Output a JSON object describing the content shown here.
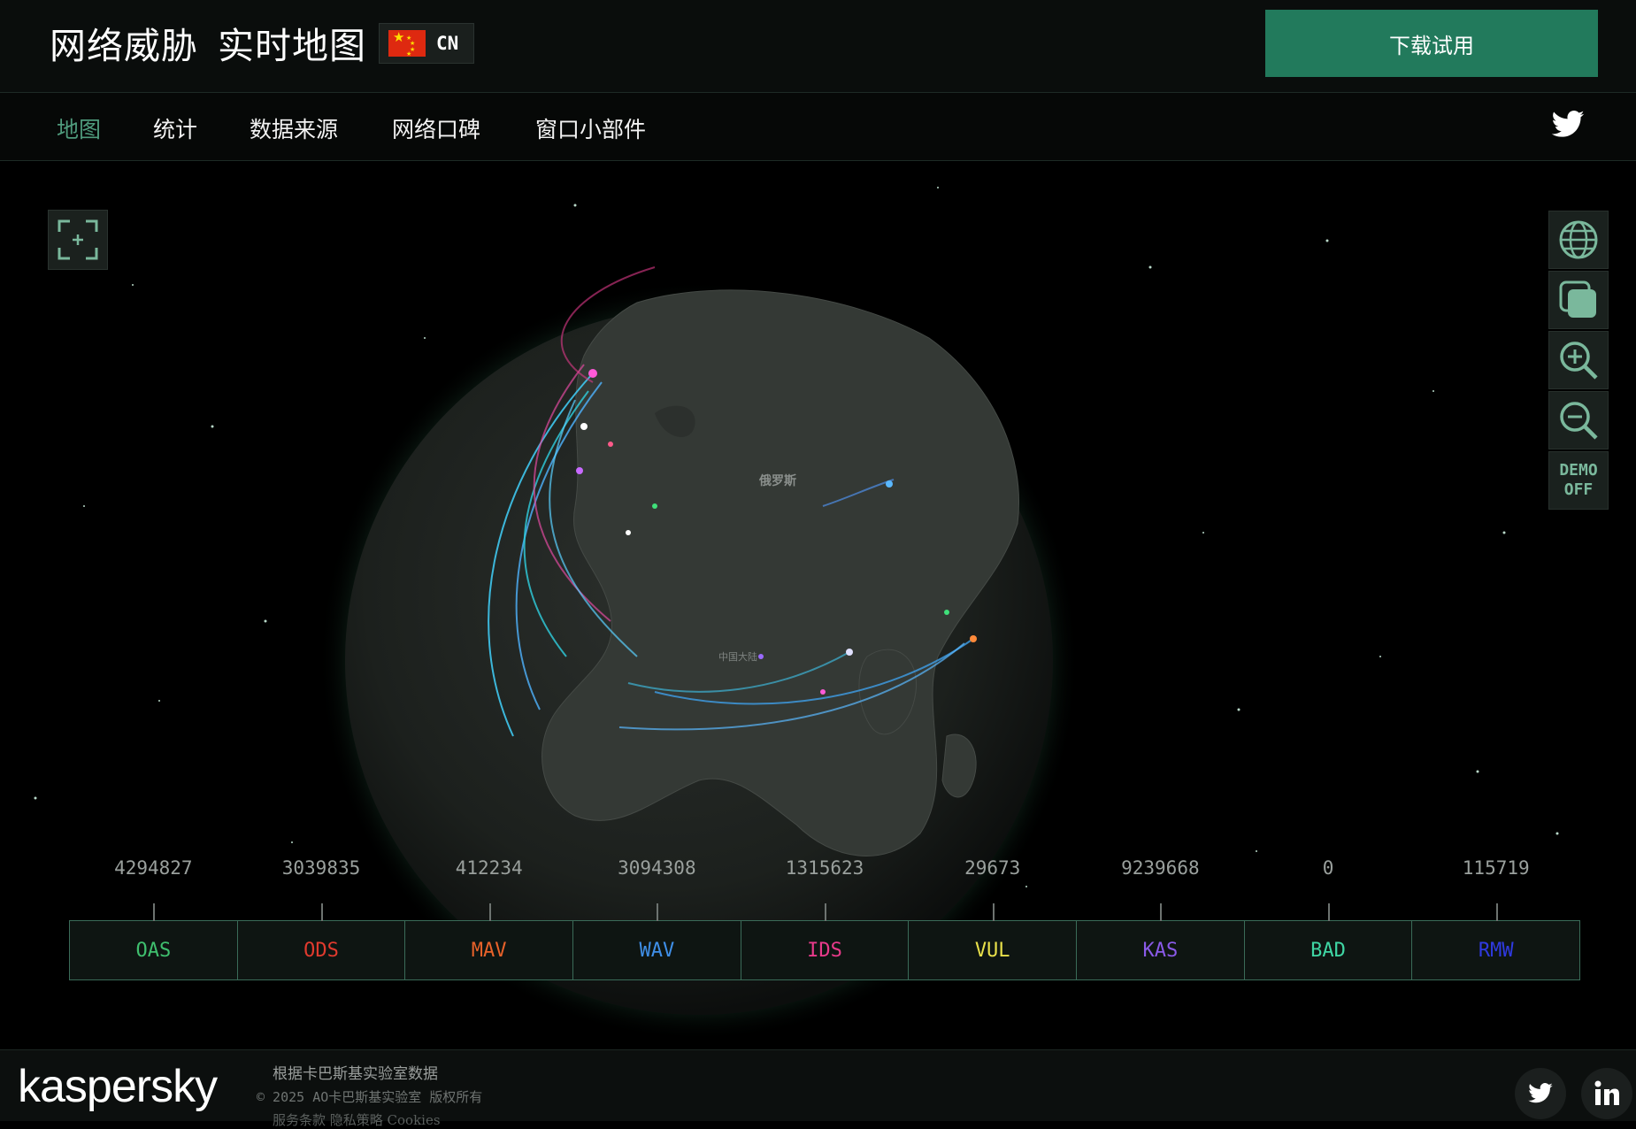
{
  "header": {
    "title_part1": "网络威胁",
    "title_part2": "实时地图",
    "language_code": "CN",
    "cta_label": "下载试用"
  },
  "nav": {
    "items": [
      "地图",
      "统计",
      "数据来源",
      "网络口碑",
      "窗口小部件"
    ],
    "active": "地图"
  },
  "map": {
    "country_labels": [
      "俄罗斯",
      "中国大陆"
    ],
    "controls": {
      "demo_line1": "DEMO",
      "demo_line2": "OFF"
    }
  },
  "stats": [
    {
      "code": "OAS",
      "value": "4294827",
      "color": "#3fbf6e"
    },
    {
      "code": "ODS",
      "value": "3039835",
      "color": "#e03a2e"
    },
    {
      "code": "MAV",
      "value": "412234",
      "color": "#e8622a"
    },
    {
      "code": "WAV",
      "value": "3094308",
      "color": "#3f8fe8"
    },
    {
      "code": "IDS",
      "value": "1315623",
      "color": "#e83a8a"
    },
    {
      "code": "VUL",
      "value": "29673",
      "color": "#e8e04a"
    },
    {
      "code": "KAS",
      "value": "9239668",
      "color": "#8a5ae8"
    },
    {
      "code": "BAD",
      "value": "0",
      "color": "#3fd6a4"
    },
    {
      "code": "RMW",
      "value": "115719",
      "color": "#2f3ae0"
    }
  ],
  "footer": {
    "logo": "kaspersky",
    "line1": "根据卡巴斯基实验室数据",
    "line2": "© 2025 AO卡巴斯基实验室 版权所有",
    "line3": "服务条款  隐私策略  Cookies"
  },
  "icons": {
    "twitter": "twitter-icon",
    "linkedin": "linkedin-icon",
    "globe": "globe-icon",
    "layers": "layers-icon",
    "zoom_in": "zoom-in-icon",
    "zoom_out": "zoom-out-icon",
    "fullscreen": "fullscreen-icon"
  }
}
